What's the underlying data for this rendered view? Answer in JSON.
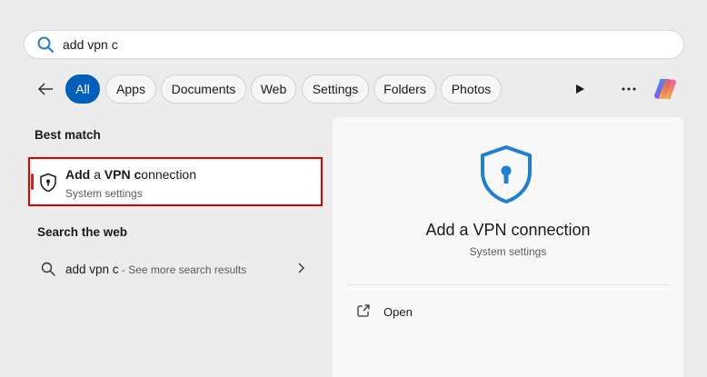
{
  "search": {
    "query": "add vpn c"
  },
  "filters": [
    {
      "label": "All",
      "active": true
    },
    {
      "label": "Apps",
      "active": false
    },
    {
      "label": "Documents",
      "active": false
    },
    {
      "label": "Web",
      "active": false
    },
    {
      "label": "Settings",
      "active": false
    },
    {
      "label": "Folders",
      "active": false
    },
    {
      "label": "Photos",
      "active": false
    }
  ],
  "icons": {
    "search": "search-icon",
    "back": "back-arrow-icon",
    "play": "play-icon",
    "more": "more-icon",
    "copilot": "copilot-icon",
    "shield": "shield-icon",
    "open": "open-external-icon",
    "chevron": "chevron-right-icon"
  },
  "best_match": {
    "heading": "Best match",
    "title_bold_1": "Add",
    "title_plain_1": " a ",
    "title_bold_2": "VPN",
    "title_plain_2": " ",
    "title_bold_3": "c",
    "title_plain_3": "onnection",
    "subtitle": "System settings"
  },
  "web": {
    "heading": "Search the web",
    "query": "add vpn c",
    "hint": " - See more search results"
  },
  "preview": {
    "title": "Add a VPN connection",
    "subtitle": "System settings",
    "open_label": "Open"
  },
  "colors": {
    "accent": "#005fb8",
    "shield_blue": "#1e7fd6",
    "highlight_border": "#e00000"
  }
}
